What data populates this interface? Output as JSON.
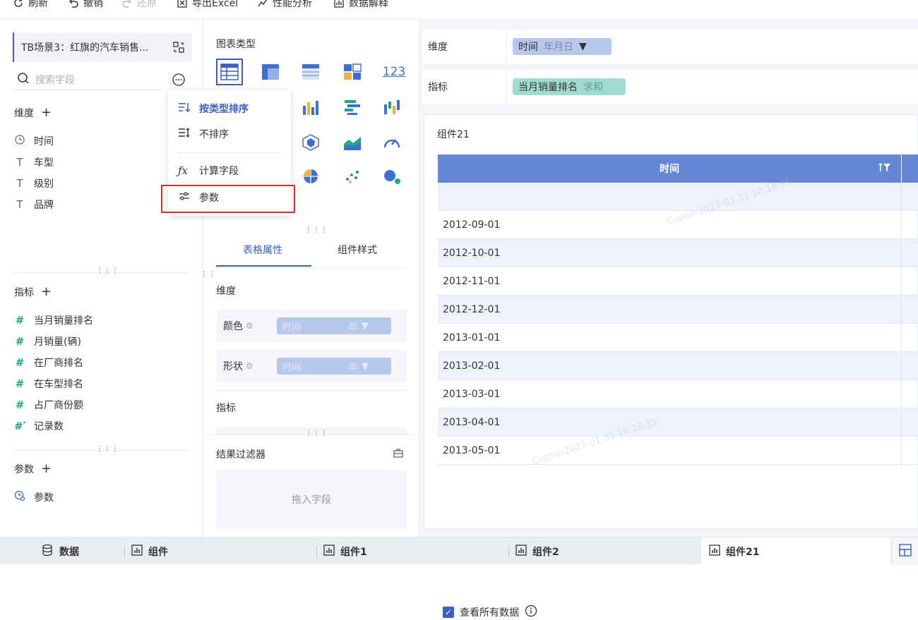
{
  "toolbar": {
    "refresh": "刷新",
    "undo": "撤销",
    "redo": "还原",
    "export": "导出Excel",
    "perf": "性能分析",
    "explain": "数据解释"
  },
  "left": {
    "dataset": "TB场景3：红旗的汽车销售...",
    "search_placeholder": "搜索字段",
    "dim_title": "维度",
    "dims": [
      "时间",
      "车型",
      "级别",
      "品牌"
    ],
    "measure_title": "指标",
    "measures": [
      "当月销量排名",
      "月销量(辆)",
      "在厂商排名",
      "在车型排名",
      "占厂商份额",
      "记录数"
    ],
    "param_title": "参数",
    "params": [
      "参数"
    ]
  },
  "menu": {
    "items": [
      "按类型排序",
      "不排序",
      "计算字段",
      "参数"
    ]
  },
  "middle": {
    "chart_type_title": "图表类型",
    "tab_table": "表格属性",
    "tab_style": "组件样式",
    "dim_label": "维度",
    "color_label": "颜色",
    "shape_label": "形状",
    "pill_field": "时间",
    "pill_unit": "年",
    "measure_label": "指标",
    "filter_title": "结果过滤器",
    "filter_placeholder": "拖入字段",
    "hidden_fragment": "表格"
  },
  "right": {
    "dim_label": "维度",
    "dim_pill": "时间",
    "dim_pill_sub": "年月日",
    "measure_label": "指标",
    "measure_pill": "当月销量排名",
    "measure_pill_sub": "求和",
    "component_title": "组件21",
    "table_header": "时间",
    "rows": [
      "",
      "2012-09-01",
      "2012-10-01",
      "2012-11-01",
      "2012-12-01",
      "2013-01-01",
      "2013-02-01",
      "2013-03-01",
      "2013-04-01",
      "2013-05-01"
    ],
    "watermark": "Copper2023-01-31 10:18:35",
    "view_all": "查看所有数据"
  },
  "bottom_tabs": [
    "数据",
    "组件",
    "组件1",
    "组件2",
    "组件21"
  ],
  "colors": {
    "accent": "#3d5fc4",
    "table_header": "#6688d4",
    "highlight_border": "#e52a2a",
    "measure_green": "#1fa68d"
  }
}
